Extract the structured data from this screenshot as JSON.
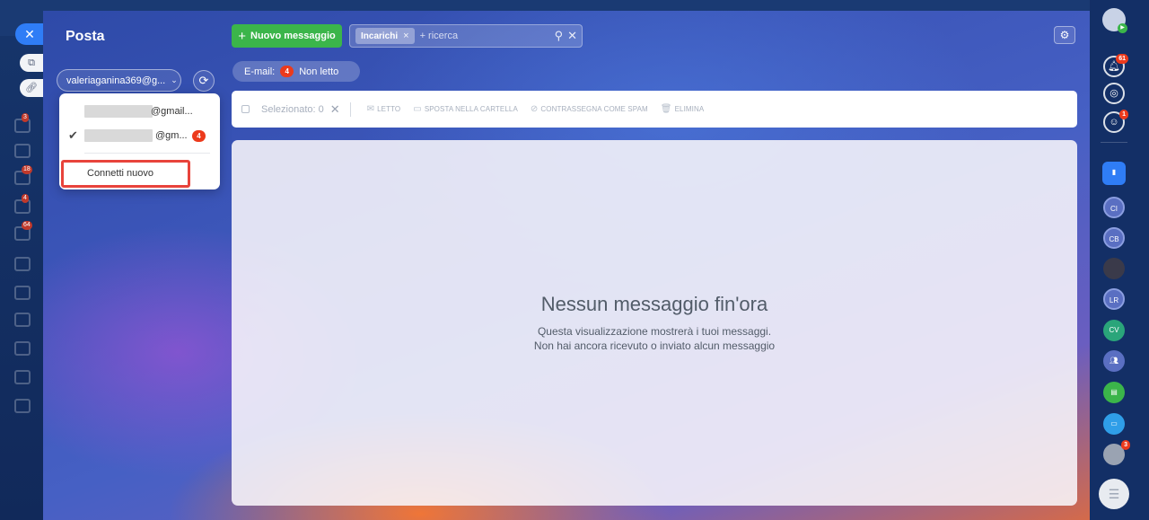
{
  "app": {
    "title": "Posta"
  },
  "toolbar": {
    "new_message": "Nuovo messaggio",
    "filter_chip": "Incarichi",
    "search_placeholder": "+ ricerca"
  },
  "account": {
    "selected": "valeriaganina369@g...",
    "list": [
      {
        "email_suffix": "@gmail...",
        "selected": false,
        "badge": ""
      },
      {
        "email_suffix": "@gm...",
        "selected": true,
        "badge": "4"
      }
    ],
    "connect_new": "Connetti nuovo"
  },
  "filter": {
    "label": "E-mail:",
    "count": "4",
    "status": "Non letto"
  },
  "actions": {
    "selected": "Selezionato: 0",
    "items": [
      "LETTO",
      "SPOSTA NELLA CARTELLA",
      "CONTRASSEGNA COME SPAM",
      "ELIMINA"
    ]
  },
  "empty": {
    "title": "Nessun messaggio fin'ora",
    "line1": "Questa visualizzazione mostrerà i tuoi messaggi.",
    "line2": "Non hai ancora ricevuto o inviato alcun messaggio"
  },
  "right_sidebar": {
    "notifications_badge": "61",
    "chat_badge": "1",
    "avatars": [
      "CI",
      "CB",
      "LR",
      "CV"
    ],
    "user_badge": "3"
  },
  "left_sidebar_badges": [
    "3",
    "18",
    "4",
    "64"
  ],
  "colors": {
    "accent_green": "#3bb54a",
    "badge_red": "#ec3a1c",
    "highlight": "#e8433b"
  }
}
